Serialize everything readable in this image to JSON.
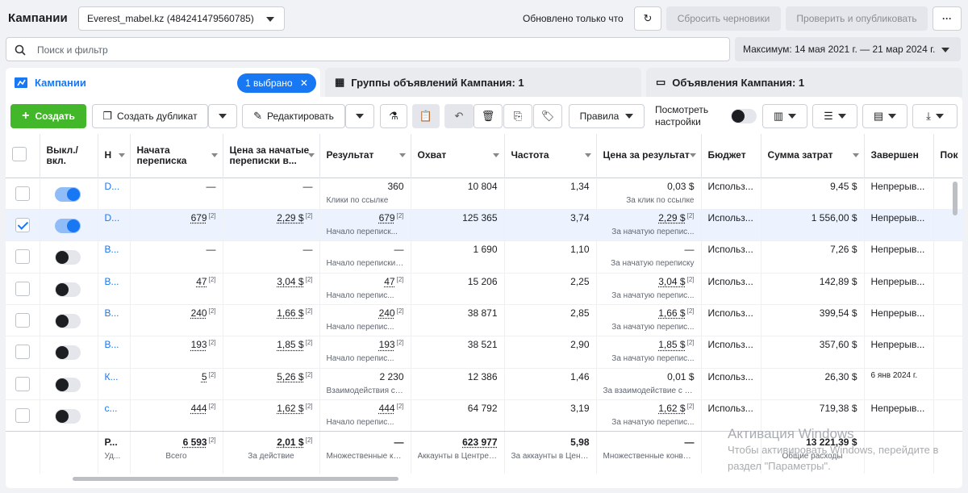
{
  "header": {
    "title": "Кампании",
    "account": "Everest_mabel.kz (484241479560785)",
    "updated": "Обновлено только что",
    "discard_label": "Сбросить черновики",
    "publish_label": "Проверить и опубликовать",
    "more_label": "···"
  },
  "search": {
    "placeholder": "Поиск и фильтр"
  },
  "date_range": "Максимум: 14 мая 2021 г. — 21 мар 2024 г.",
  "tabs": [
    {
      "label": "Кампании",
      "badge": "1 выбрано"
    },
    {
      "label": "Группы объявлений Кампания: 1"
    },
    {
      "label": "Объявления Кампания: 1"
    }
  ],
  "toolbar": {
    "create": "Создать",
    "duplicate": "Создать дубликат",
    "edit": "Редактировать",
    "rules": "Правила",
    "view_settings_line1": "Посмотреть",
    "view_settings_line2": "настройки"
  },
  "columns": [
    "Выкл./ вкл.",
    "Н",
    "Начата переписка",
    "Цена за начатые переписки в...",
    "Результат",
    "Охват",
    "Частота",
    "Цена за результат",
    "Бюджет",
    "Сумма затрат",
    "Завершен",
    "Пок"
  ],
  "rows": [
    {
      "name": "D...",
      "on": true,
      "selected": false,
      "conv": "—",
      "conv_price": "—",
      "result": "360",
      "result_sub": "Клики по ссылке",
      "reach": "10 804",
      "freq": "1,34",
      "cpr": "0,03 $",
      "cpr_sub": "За клик по ссылке",
      "budget": "Использ...",
      "spend": "9,45 $",
      "end": "Непрерыв..."
    },
    {
      "name": "D...",
      "on": true,
      "selected": true,
      "conv": "679",
      "conv_price": "2,29 $",
      "result": "679",
      "result_sub": "Начало переписк...",
      "reach": "125 365",
      "freq": "3,74",
      "cpr": "2,29 $",
      "cpr_sub": "За начатую перепис...",
      "budget": "Использ...",
      "spend": "1 556,00 $",
      "end": "Непрерыв..."
    },
    {
      "name": "В...",
      "on": false,
      "selected": false,
      "conv": "—",
      "conv_price": "—",
      "result": "—",
      "result_sub": "Начало переписки ...",
      "reach": "1 690",
      "freq": "1,10",
      "cpr": "—",
      "cpr_sub": "За начатую переписку",
      "budget": "Использ...",
      "spend": "7,26 $",
      "end": "Непрерыв..."
    },
    {
      "name": "В...",
      "on": false,
      "selected": false,
      "conv": "47",
      "conv_price": "3,04 $",
      "result": "47",
      "result_sub": "Начало перепис...",
      "reach": "15 206",
      "freq": "2,25",
      "cpr": "3,04 $",
      "cpr_sub": "За начатую перепис...",
      "budget": "Использ...",
      "spend": "142,89 $",
      "end": "Непрерыв..."
    },
    {
      "name": "В...",
      "on": false,
      "selected": false,
      "conv": "240",
      "conv_price": "1,66 $",
      "result": "240",
      "result_sub": "Начало перепис...",
      "reach": "38 871",
      "freq": "2,85",
      "cpr": "1,66 $",
      "cpr_sub": "За начатую перепис...",
      "budget": "Использ...",
      "spend": "399,54 $",
      "end": "Непрерыв..."
    },
    {
      "name": "В...",
      "on": false,
      "selected": false,
      "conv": "193",
      "conv_price": "1,85 $",
      "result": "193",
      "result_sub": "Начало перепис...",
      "reach": "38 521",
      "freq": "2,90",
      "cpr": "1,85 $",
      "cpr_sub": "За начатую перепис...",
      "budget": "Использ...",
      "spend": "357,60 $",
      "end": "Непрерыв..."
    },
    {
      "name": "К...",
      "on": false,
      "selected": false,
      "conv": "5",
      "conv_price": "5,26 $",
      "result": "2 230",
      "result_sub": "Взаимодействия с ...",
      "reach": "12 386",
      "freq": "1,46",
      "cpr": "0,01 $",
      "cpr_sub": "За взаимодействие с п...",
      "budget": "Использ...",
      "spend": "26,30 $",
      "end": "6 янв 2024 г."
    },
    {
      "name": "с...",
      "on": false,
      "selected": false,
      "conv": "444",
      "conv_price": "1,62 $",
      "result": "444",
      "result_sub": "Начало перепис...",
      "reach": "64 792",
      "freq": "3,19",
      "cpr": "1,62 $",
      "cpr_sub": "За начатую перепис...",
      "budget": "Использ...",
      "spend": "719,38 $",
      "end": "Непрерыв..."
    }
  ],
  "footer": {
    "name": "Р...",
    "name_sub": "Уд...",
    "conv": "6 593",
    "conv_sub": "Всего",
    "conv_price": "2,01 $",
    "conv_price_sub": "За действие",
    "result": "—",
    "result_sub": "Множественные ко...",
    "reach": "623 977",
    "reach_sub": "Аккаунты в Центре ...",
    "freq": "5,98",
    "freq_sub": "За аккаунты в Цент...",
    "cpr": "—",
    "cpr_sub": "Множественные конве...",
    "spend": "13 221,39 $",
    "spend_sub": "Общие расходы"
  },
  "watermark": {
    "line1": "Активация Windows",
    "line2": "Чтобы активировать Windows, перейдите в",
    "line3": "раздел \"Параметры\"."
  },
  "colors": {
    "accent": "#1877f2",
    "create": "#42b72a"
  }
}
